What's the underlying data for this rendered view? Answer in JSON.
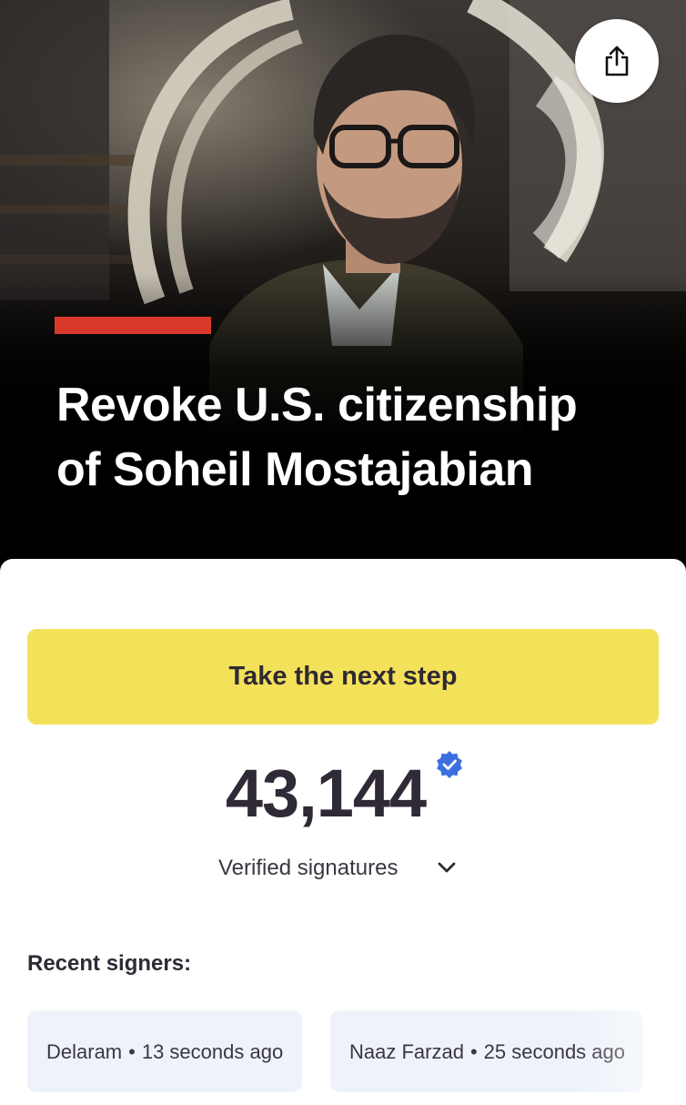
{
  "hero": {
    "title_line1": "Revoke U.S. citizenship",
    "title_line2": "of Soheil Mostajabian",
    "accent_color": "#d9392b",
    "share_icon": "share-icon"
  },
  "petition": {
    "cta_label": "Take the next step",
    "cta_color": "#f4e15a",
    "signature_count": "43,144",
    "signature_label": "Verified signatures",
    "verified_icon": "verified-badge-icon",
    "expand_icon": "chevron-down-icon"
  },
  "recent": {
    "heading": "Recent signers:",
    "signers": [
      {
        "name": "Delaram",
        "time": "13 seconds ago"
      },
      {
        "name": "Naaz Farzad",
        "time": "25 seconds ago"
      }
    ]
  }
}
